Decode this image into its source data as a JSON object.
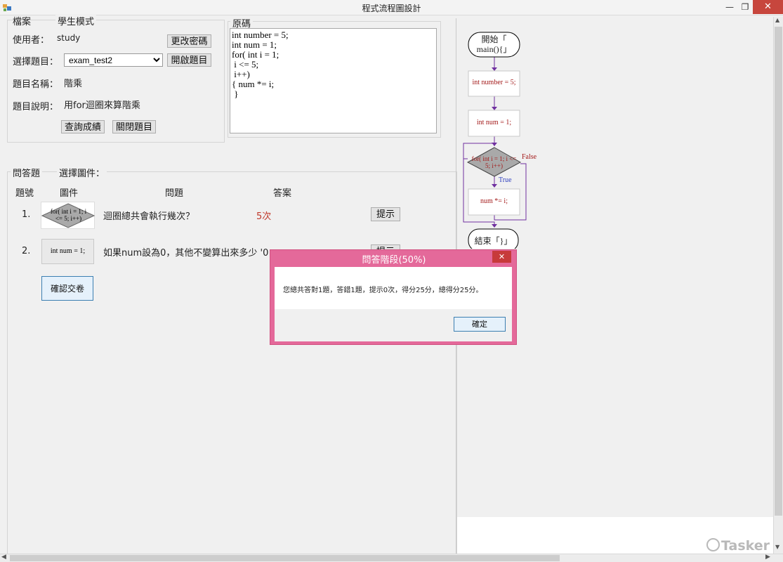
{
  "window": {
    "title": "程式流程圖設計"
  },
  "menu": {
    "file": "檔案",
    "mode": "學生模式"
  },
  "user": {
    "label": "使用者：",
    "name": "study",
    "change_password_button": "更改密碼"
  },
  "exam": {
    "select_label": "選擇題目：",
    "selected": "exam_test2",
    "open_button": "開啟題目",
    "name_label": "題目名稱：",
    "name_value": "階乘",
    "desc_label": "題目說明：",
    "desc_value": "用for迴圈來算階乘",
    "query_score_button": "查詢成績",
    "close_exam_button": "關閉題目"
  },
  "source": {
    "title": "原碼",
    "code": "int number = 5;\nint num = 1;\nfor( int i = 1;\n i <= 5;\n i++)\n{ num *= i;\n }"
  },
  "qa": {
    "title": "問答題",
    "select_component_label": "選擇圖件：",
    "headers": {
      "number": "題號",
      "component": "圖件",
      "question": "問題",
      "answer": "答案"
    },
    "rows": [
      {
        "number": "1.",
        "component_text": "for( int i = 1; i <= 5; i++)",
        "question": "迴圈總共會執行幾次？",
        "answer": "5次",
        "hint_button": "提示"
      },
      {
        "number": "2.",
        "component_text": "int num = 1;",
        "question": "如果num設為0，其他不變算出來多少 '0",
        "answer": "",
        "hint_button": "提示"
      }
    ],
    "submit_button": "確認交卷"
  },
  "flowchart": {
    "start": "開始「 main(){」",
    "step1": "int number = 5;",
    "step2": "int num = 1;",
    "decision": "for( int i = 1; i <= 5; i++)",
    "false_label": "False",
    "true_label": "True",
    "body": "num *= i;",
    "end": "結束「}」"
  },
  "modal": {
    "title": "問答階段(50%)",
    "message": "您總共答對1題，答錯1題，提示0次，得分25分，總得分25分。",
    "ok_button": "確定"
  },
  "watermark": {
    "text": "Tasker"
  },
  "colors": {
    "answer_red": "#c0392b",
    "flow_text": "#a31a1a",
    "flow_arrow": "#7030a0",
    "modal_border": "#e4699a"
  }
}
